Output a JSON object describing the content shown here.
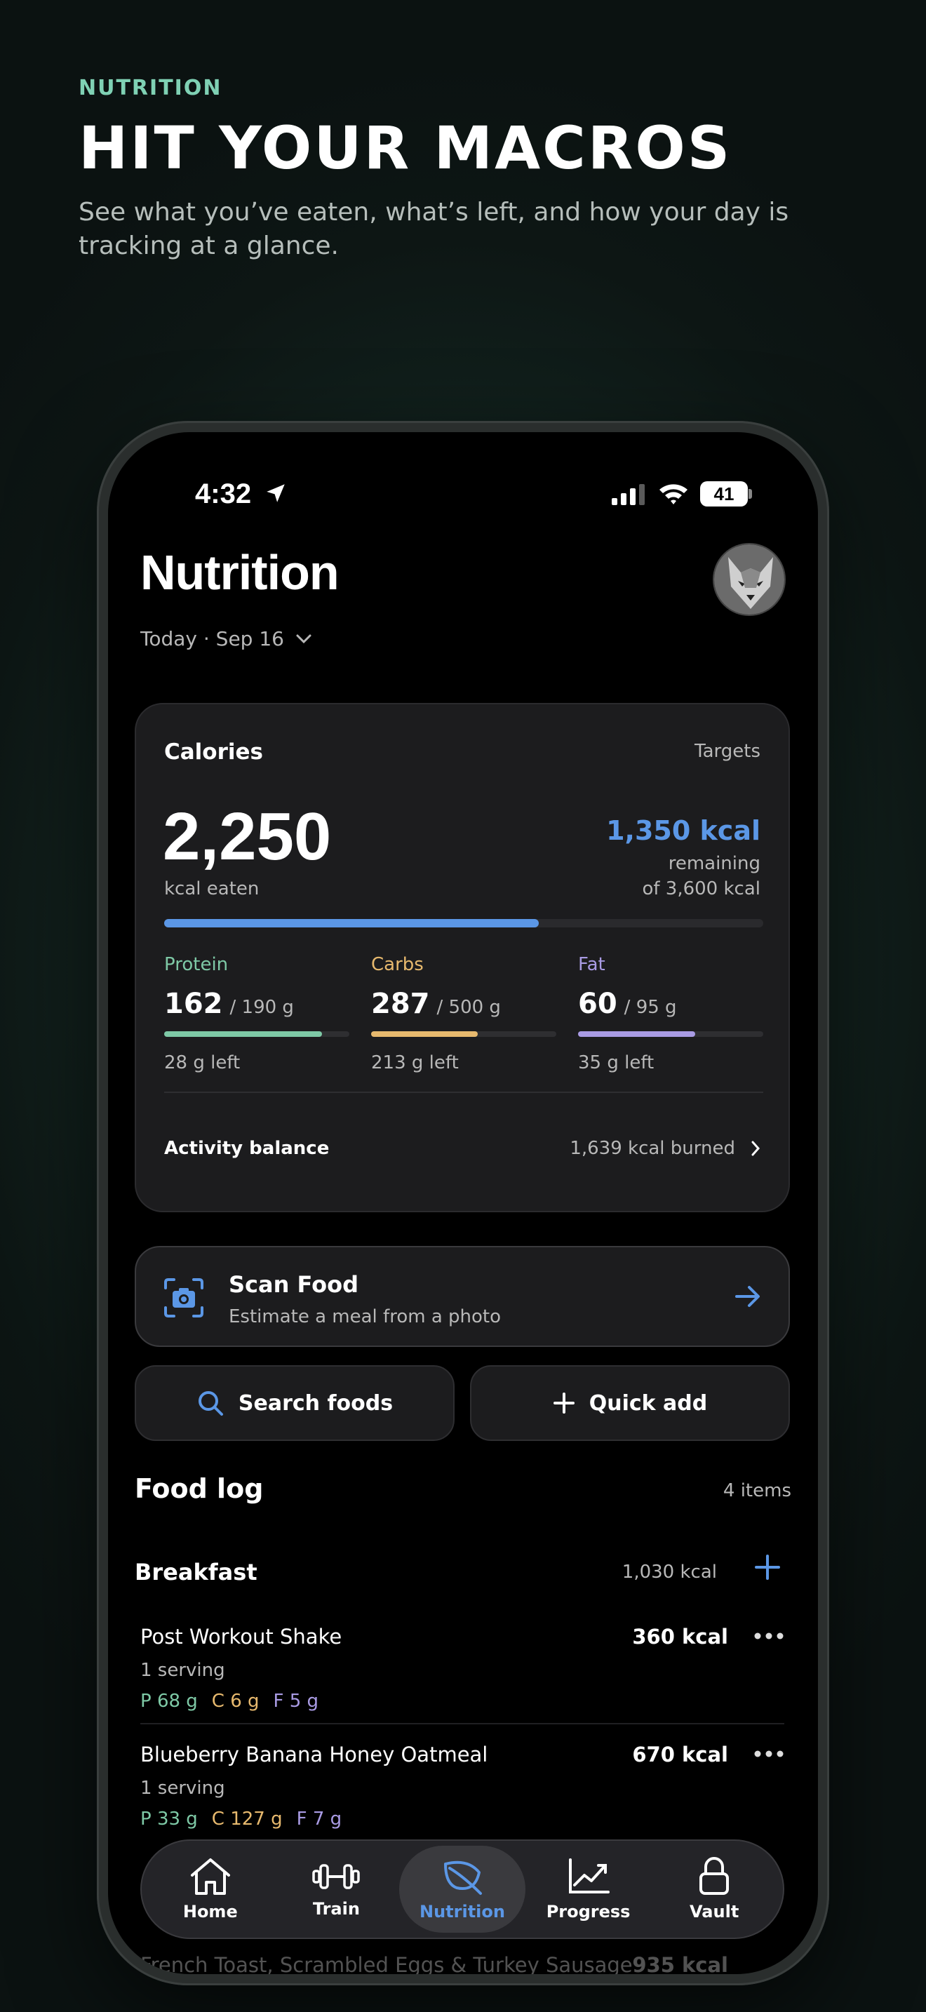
{
  "hero": {
    "eyebrow": "NUTRITION",
    "title": "HIT YOUR MACROS",
    "subtitle": "See what you’ve eaten, what’s left, and how your day is tracking at a glance."
  },
  "status_bar": {
    "time": "4:32",
    "battery": "41"
  },
  "header": {
    "title": "Nutrition",
    "date_label": "Today · Sep 16"
  },
  "calories": {
    "label": "Calories",
    "targets_link": "Targets",
    "eaten": "2,250",
    "eaten_label": "kcal eaten",
    "remaining": "1,350 kcal",
    "remaining_label": "remaining",
    "of_label": "of 3,600 kcal",
    "progress_fraction": 0.625
  },
  "macros": [
    {
      "name": "Protein",
      "eaten": "162",
      "target": "/ 190 g",
      "left": "28 g left",
      "fraction": 0.853,
      "color": "#7ec9a6"
    },
    {
      "name": "Carbs",
      "eaten": "287",
      "target": "/ 500 g",
      "left": "213 g left",
      "fraction": 0.574,
      "color": "#e7b96e"
    },
    {
      "name": "Fat",
      "eaten": "60",
      "target": "/ 95 g",
      "left": "35 g left",
      "fraction": 0.632,
      "color": "#a99be4"
    }
  ],
  "activity": {
    "label": "Activity balance",
    "value": "1,639 kcal burned"
  },
  "scan": {
    "title": "Scan Food",
    "subtitle": "Estimate a meal from a photo"
  },
  "actions": {
    "search": "Search foods",
    "quick_add": "Quick add"
  },
  "food_log": {
    "title": "Food log",
    "count": "4 items",
    "meal": {
      "name": "Breakfast",
      "kcal": "1,030 kcal"
    },
    "items": [
      {
        "name": "Post Workout Shake",
        "serving": "1 serving",
        "kcal": "360 kcal",
        "p": "P 68 g",
        "c": "C 6 g",
        "f": "F 5 g"
      },
      {
        "name": "Blueberry Banana Honey Oatmeal",
        "serving": "1 serving",
        "kcal": "670 kcal",
        "p": "P 33 g",
        "c": "C 127 g",
        "f": "F 7 g"
      }
    ],
    "next_item": {
      "name": "French Toast, Scrambled Eggs & Turkey Sausage",
      "kcal": "935 kcal"
    }
  },
  "tabs": [
    {
      "label": "Home",
      "icon": "home-icon"
    },
    {
      "label": "Train",
      "icon": "dumbbell-icon"
    },
    {
      "label": "Nutrition",
      "icon": "leaf-icon",
      "active": true
    },
    {
      "label": "Progress",
      "icon": "chart-icon"
    },
    {
      "label": "Vault",
      "icon": "lock-icon"
    }
  ],
  "colors": {
    "accent": "#5b97e6",
    "protein": "#7ec9a6",
    "carbs": "#e7b96e",
    "fat": "#a99be4",
    "eyebrow": "#7fd1b4"
  }
}
